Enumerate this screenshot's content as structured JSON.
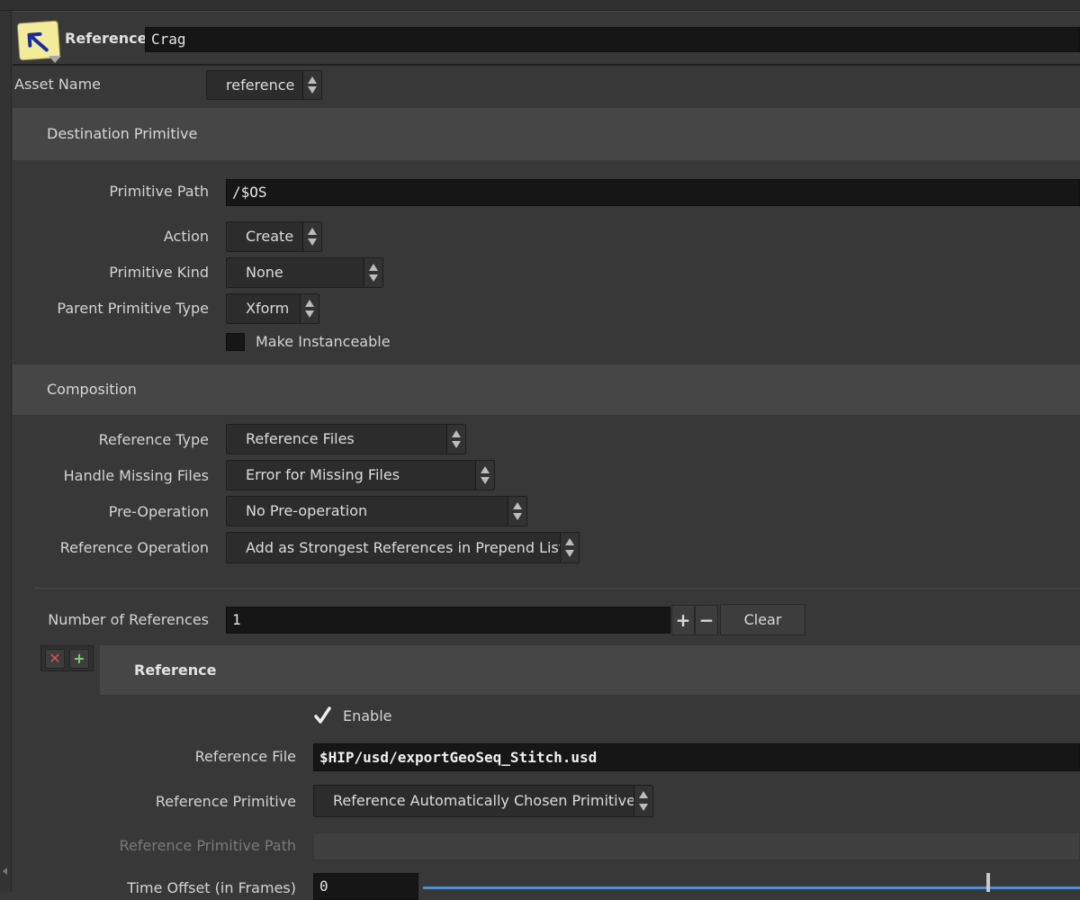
{
  "node": {
    "type_label": "Reference",
    "name": "Crag",
    "icon": "reference-node-icon"
  },
  "asset_name": {
    "label": "Asset Name",
    "value": "reference"
  },
  "destination": {
    "title": "Destination Primitive",
    "primitive_path_label": "Primitive Path",
    "primitive_path": "/$OS",
    "action_label": "Action",
    "action": "Create",
    "primitive_kind_label": "Primitive Kind",
    "primitive_kind": "None",
    "parent_type_label": "Parent Primitive Type",
    "parent_type": "Xform",
    "instanceable_label": "Make Instanceable",
    "instanceable": false
  },
  "composition": {
    "title": "Composition",
    "reference_type_label": "Reference Type",
    "reference_type": "Reference Files",
    "handle_missing_label": "Handle Missing Files",
    "handle_missing": "Error for Missing Files",
    "pre_operation_label": "Pre-Operation",
    "pre_operation": "No Pre-operation",
    "reference_operation_label": "Reference Operation",
    "reference_operation": "Add as Strongest References in Prepend List"
  },
  "references": {
    "count_label": "Number of References",
    "count": "1",
    "plus": "+",
    "minus": "−",
    "clear_label": "Clear",
    "instance": {
      "title": "Reference",
      "enable_label": "Enable",
      "enabled": true,
      "file_label": "Reference File",
      "file": "$HIP/usd/exportGeoSeq_Stitch.usd",
      "primitive_label": "Reference Primitive",
      "primitive": "Reference Automatically Chosen Primitive",
      "primitive_path_label": "Reference Primitive Path",
      "primitive_path": "",
      "time_offset_label": "Time Offset (in Frames)",
      "time_offset": "0"
    }
  },
  "colors": {
    "background": "#383838",
    "section": "#464646",
    "field": "#161616",
    "note_icon": "#f2ec9a",
    "slider_accent": "#4f8fd8"
  }
}
